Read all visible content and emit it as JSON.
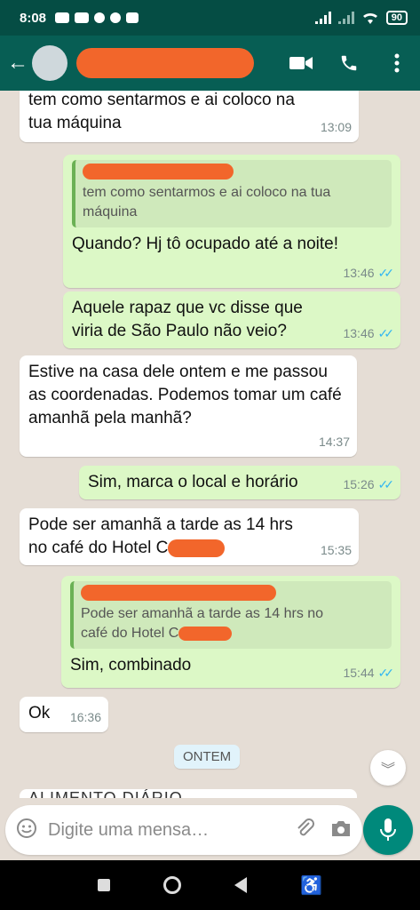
{
  "status_bar": {
    "time": "8:08",
    "battery": "90"
  },
  "header": {
    "back_icon": "arrow-back-icon",
    "contact_name": "",
    "actions": [
      "video-call-icon",
      "phone-icon",
      "more-vert-icon"
    ]
  },
  "messages": [
    {
      "dir": "in",
      "text": "tem como sentarmos e ai coloco na tua máquina",
      "time": "13:09"
    },
    {
      "dir": "out",
      "quote": "tem como sentarmos e ai coloco na tua máquina",
      "text": "Quando? Hj tô ocupado até a noite!",
      "time": "13:46"
    },
    {
      "dir": "out",
      "text": "Aquele rapaz que vc disse que viria de São Paulo não veio?",
      "time": "13:46"
    },
    {
      "dir": "in",
      "text": "Estive na casa dele ontem e me passou as coordenadas.  Podemos tomar um café amanhã pela manhã?",
      "time": "14:37"
    },
    {
      "dir": "out",
      "text": "Sim, marca o local e horário",
      "time": "15:26"
    },
    {
      "dir": "in",
      "text_a": "Pode ser amanhã a tarde as 14 hrs",
      "text_b": "no café do Hotel C",
      "time": "15:35"
    },
    {
      "dir": "out",
      "quote_a": "Pode ser amanhã a tarde as 14 hrs no",
      "quote_b": "café do Hotel C",
      "text": "Sim, combinado",
      "time": "15:44"
    },
    {
      "dir": "in",
      "text": "Ok",
      "time": "16:36"
    }
  ],
  "date_divider": "ONTEM",
  "partial_message": "ALIMENTO DIÁRIO",
  "input": {
    "placeholder": "Digite uma mensa…"
  },
  "colors": {
    "header": "#075e54",
    "status_bar": "#054d44",
    "outgoing": "#dcf8c6",
    "incoming": "#ffffff",
    "chat_bg": "#e5ddd5",
    "accent": "#00897b",
    "read_ticks": "#34b7f1"
  }
}
